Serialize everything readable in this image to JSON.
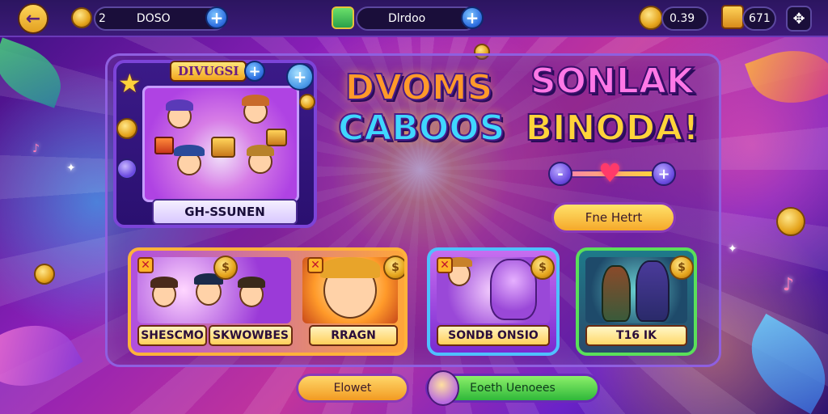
{
  "topbar": {
    "left_pill": {
      "count": "2",
      "value": "DOSO"
    },
    "center_pill": {
      "value": "Dlrdoo"
    },
    "right_pill_1": {
      "value": "0.39"
    },
    "right_pill_2": {
      "value": "671"
    }
  },
  "featured": {
    "tag": "DIVUGSI",
    "name": "GH-SSUNEN"
  },
  "titles": {
    "left_line1": "DVOMS",
    "left_line2": "CABOOS",
    "right_line1": "SONLAK",
    "right_line2": "BINODA!"
  },
  "free_button": {
    "label": "Fne Hetrt"
  },
  "cards": [
    {
      "label_left": "SHESCMO",
      "label_mid": "SKWOWBES",
      "label_right": "RRAGN"
    },
    {
      "label": "SONDB ONSIO"
    },
    {
      "label": "T16 IK"
    }
  ],
  "bottom": {
    "orange_label": "Elowet",
    "green_label": "Eoeth Uenoees"
  },
  "colors": {
    "accent_gold": "#ffc53a",
    "accent_blue": "#2f6fe0",
    "panel_border": "#8f5fe0",
    "card_a_border": "#ffb23a",
    "card_b_border": "#4fc0ff",
    "card_c_border": "#5adf5a"
  }
}
